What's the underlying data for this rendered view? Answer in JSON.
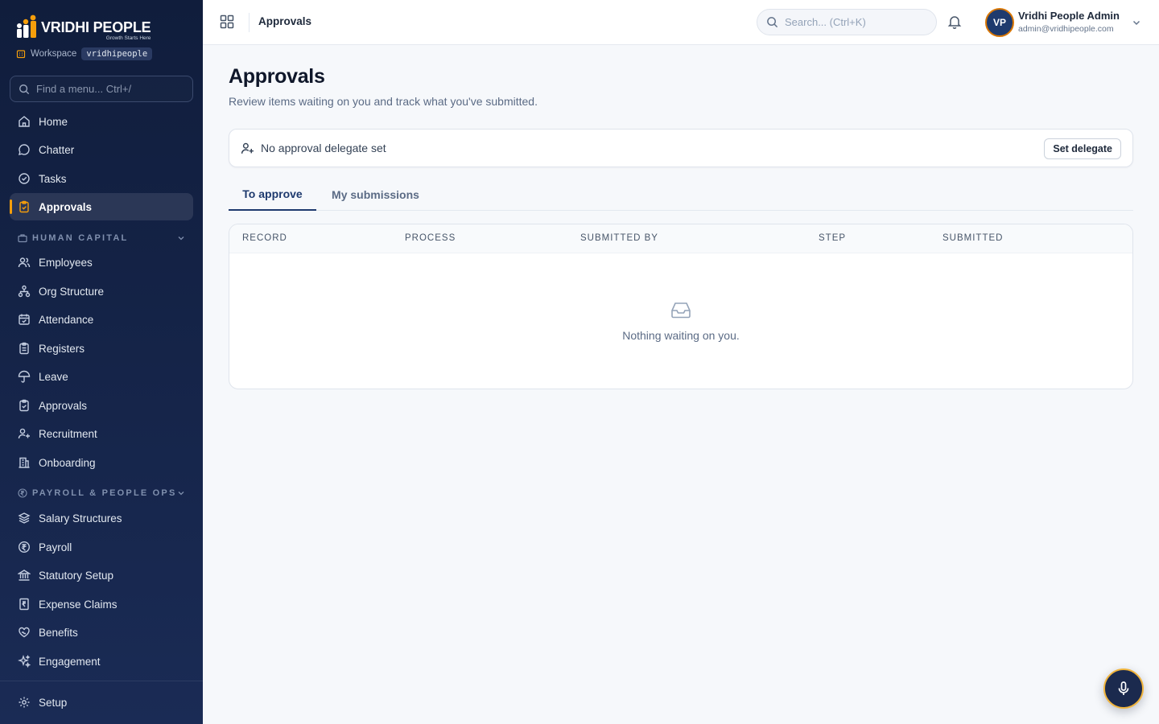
{
  "brand": {
    "name": "VRIDHI PEOPLE",
    "tagline": "Growth Starts Here"
  },
  "workspace": {
    "label": "Workspace",
    "value": "vridhipeople"
  },
  "sidebar_search": {
    "placeholder": "Find a menu... Ctrl+/"
  },
  "nav_top": [
    {
      "label": "Home",
      "icon": "home-icon"
    },
    {
      "label": "Chatter",
      "icon": "chat-icon"
    },
    {
      "label": "Tasks",
      "icon": "check-circle-icon"
    },
    {
      "label": "Approvals",
      "icon": "clipboard-check-icon",
      "active": true
    }
  ],
  "section_human_capital": {
    "title": "HUMAN CAPITAL",
    "items": [
      {
        "label": "Employees",
        "icon": "users-icon"
      },
      {
        "label": "Org Structure",
        "icon": "org-chart-icon"
      },
      {
        "label": "Attendance",
        "icon": "calendar-check-icon"
      },
      {
        "label": "Registers",
        "icon": "clipboard-list-icon"
      },
      {
        "label": "Leave",
        "icon": "umbrella-icon"
      },
      {
        "label": "Approvals",
        "icon": "clipboard-check-icon"
      },
      {
        "label": "Recruitment",
        "icon": "user-plus-icon"
      },
      {
        "label": "Onboarding",
        "icon": "building-icon"
      }
    ]
  },
  "section_payroll": {
    "title": "PAYROLL & PEOPLE OPS",
    "items": [
      {
        "label": "Salary Structures",
        "icon": "layers-icon"
      },
      {
        "label": "Payroll",
        "icon": "rupee-circle-icon"
      },
      {
        "label": "Statutory Setup",
        "icon": "bank-icon"
      },
      {
        "label": "Expense Claims",
        "icon": "receipt-icon"
      },
      {
        "label": "Benefits",
        "icon": "heart-hand-icon"
      },
      {
        "label": "Engagement",
        "icon": "sparkles-icon"
      }
    ]
  },
  "nav_bottom": {
    "label": "Setup",
    "icon": "gear-icon"
  },
  "topbar": {
    "breadcrumb": "Approvals",
    "search_placeholder": "Search... (Ctrl+K)",
    "user": {
      "initials": "VP",
      "name": "Vridhi People Admin",
      "email": "admin@vridhipeople.com"
    }
  },
  "page": {
    "title": "Approvals",
    "subtitle": "Review items waiting on you and track what you've submitted."
  },
  "delegate": {
    "text": "No approval delegate set",
    "button": "Set delegate"
  },
  "tabs": [
    {
      "label": "To approve",
      "active": true
    },
    {
      "label": "My submissions",
      "active": false
    }
  ],
  "table": {
    "columns": [
      "RECORD",
      "PROCESS",
      "SUBMITTED BY",
      "STEP",
      "SUBMITTED"
    ],
    "rows": [],
    "empty_text": "Nothing waiting on you."
  },
  "colors": {
    "sidebar_bg": "#101d3c",
    "accent": "#f59e0b",
    "primary": "#1e3a6e"
  }
}
